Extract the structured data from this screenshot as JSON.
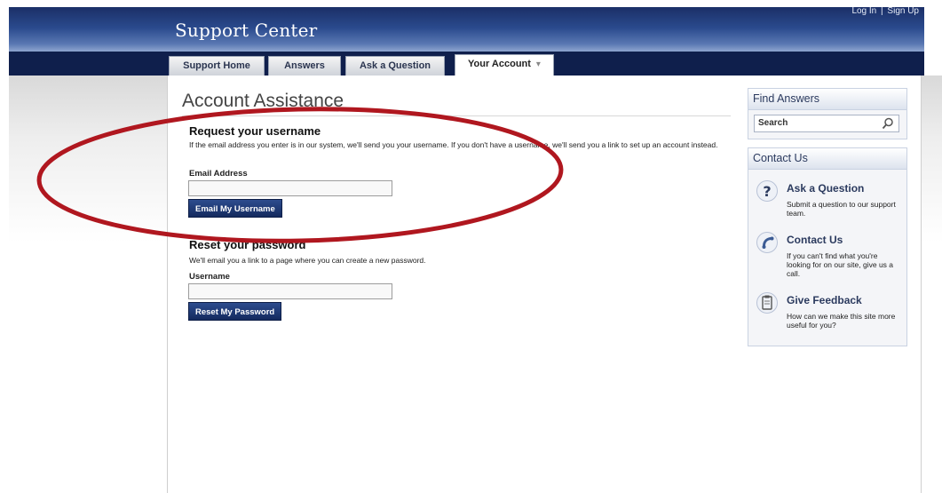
{
  "header": {
    "brand": "Support Center",
    "login_label": "Log In",
    "separator": "|",
    "signup_label": "Sign Up"
  },
  "nav": {
    "tabs": [
      {
        "label": "Support Home"
      },
      {
        "label": "Answers"
      },
      {
        "label": "Ask a Question"
      },
      {
        "label": "Your Account",
        "active": true
      }
    ],
    "dropdown_caret": "▾"
  },
  "main": {
    "page_title": "Account Assistance",
    "request_username": {
      "heading": "Request your username",
      "description": "If the email address you enter is in our system, we'll send you your username. If you don't have a username, we'll send you a link to set up an account instead.",
      "field_label": "Email Address",
      "field_value": "",
      "button_label": "Email My Username"
    },
    "reset_password": {
      "heading": "Reset your password",
      "description": "We'll email you a link to a page where you can create a new password.",
      "field_label": "Username",
      "field_value": "",
      "button_label": "Reset My Password"
    }
  },
  "sidebar": {
    "find_answers": {
      "heading": "Find Answers",
      "search_placeholder": "Search"
    },
    "contact_us": {
      "heading": "Contact Us",
      "items": [
        {
          "title": "Ask a Question",
          "description": "Submit a question to our support team.",
          "icon": "question-icon"
        },
        {
          "title": "Contact Us",
          "description": "If you can't find what you're looking for on our site, give us a call.",
          "icon": "phone-icon"
        },
        {
          "title": "Give Feedback",
          "description": "How can we make this site more useful for you?",
          "icon": "clipboard-icon"
        }
      ]
    }
  },
  "colors": {
    "header_dark": "#1b2f67",
    "navbar": "#0f1f4c",
    "button": "#1e3a78",
    "annotation": "#b0171f"
  }
}
